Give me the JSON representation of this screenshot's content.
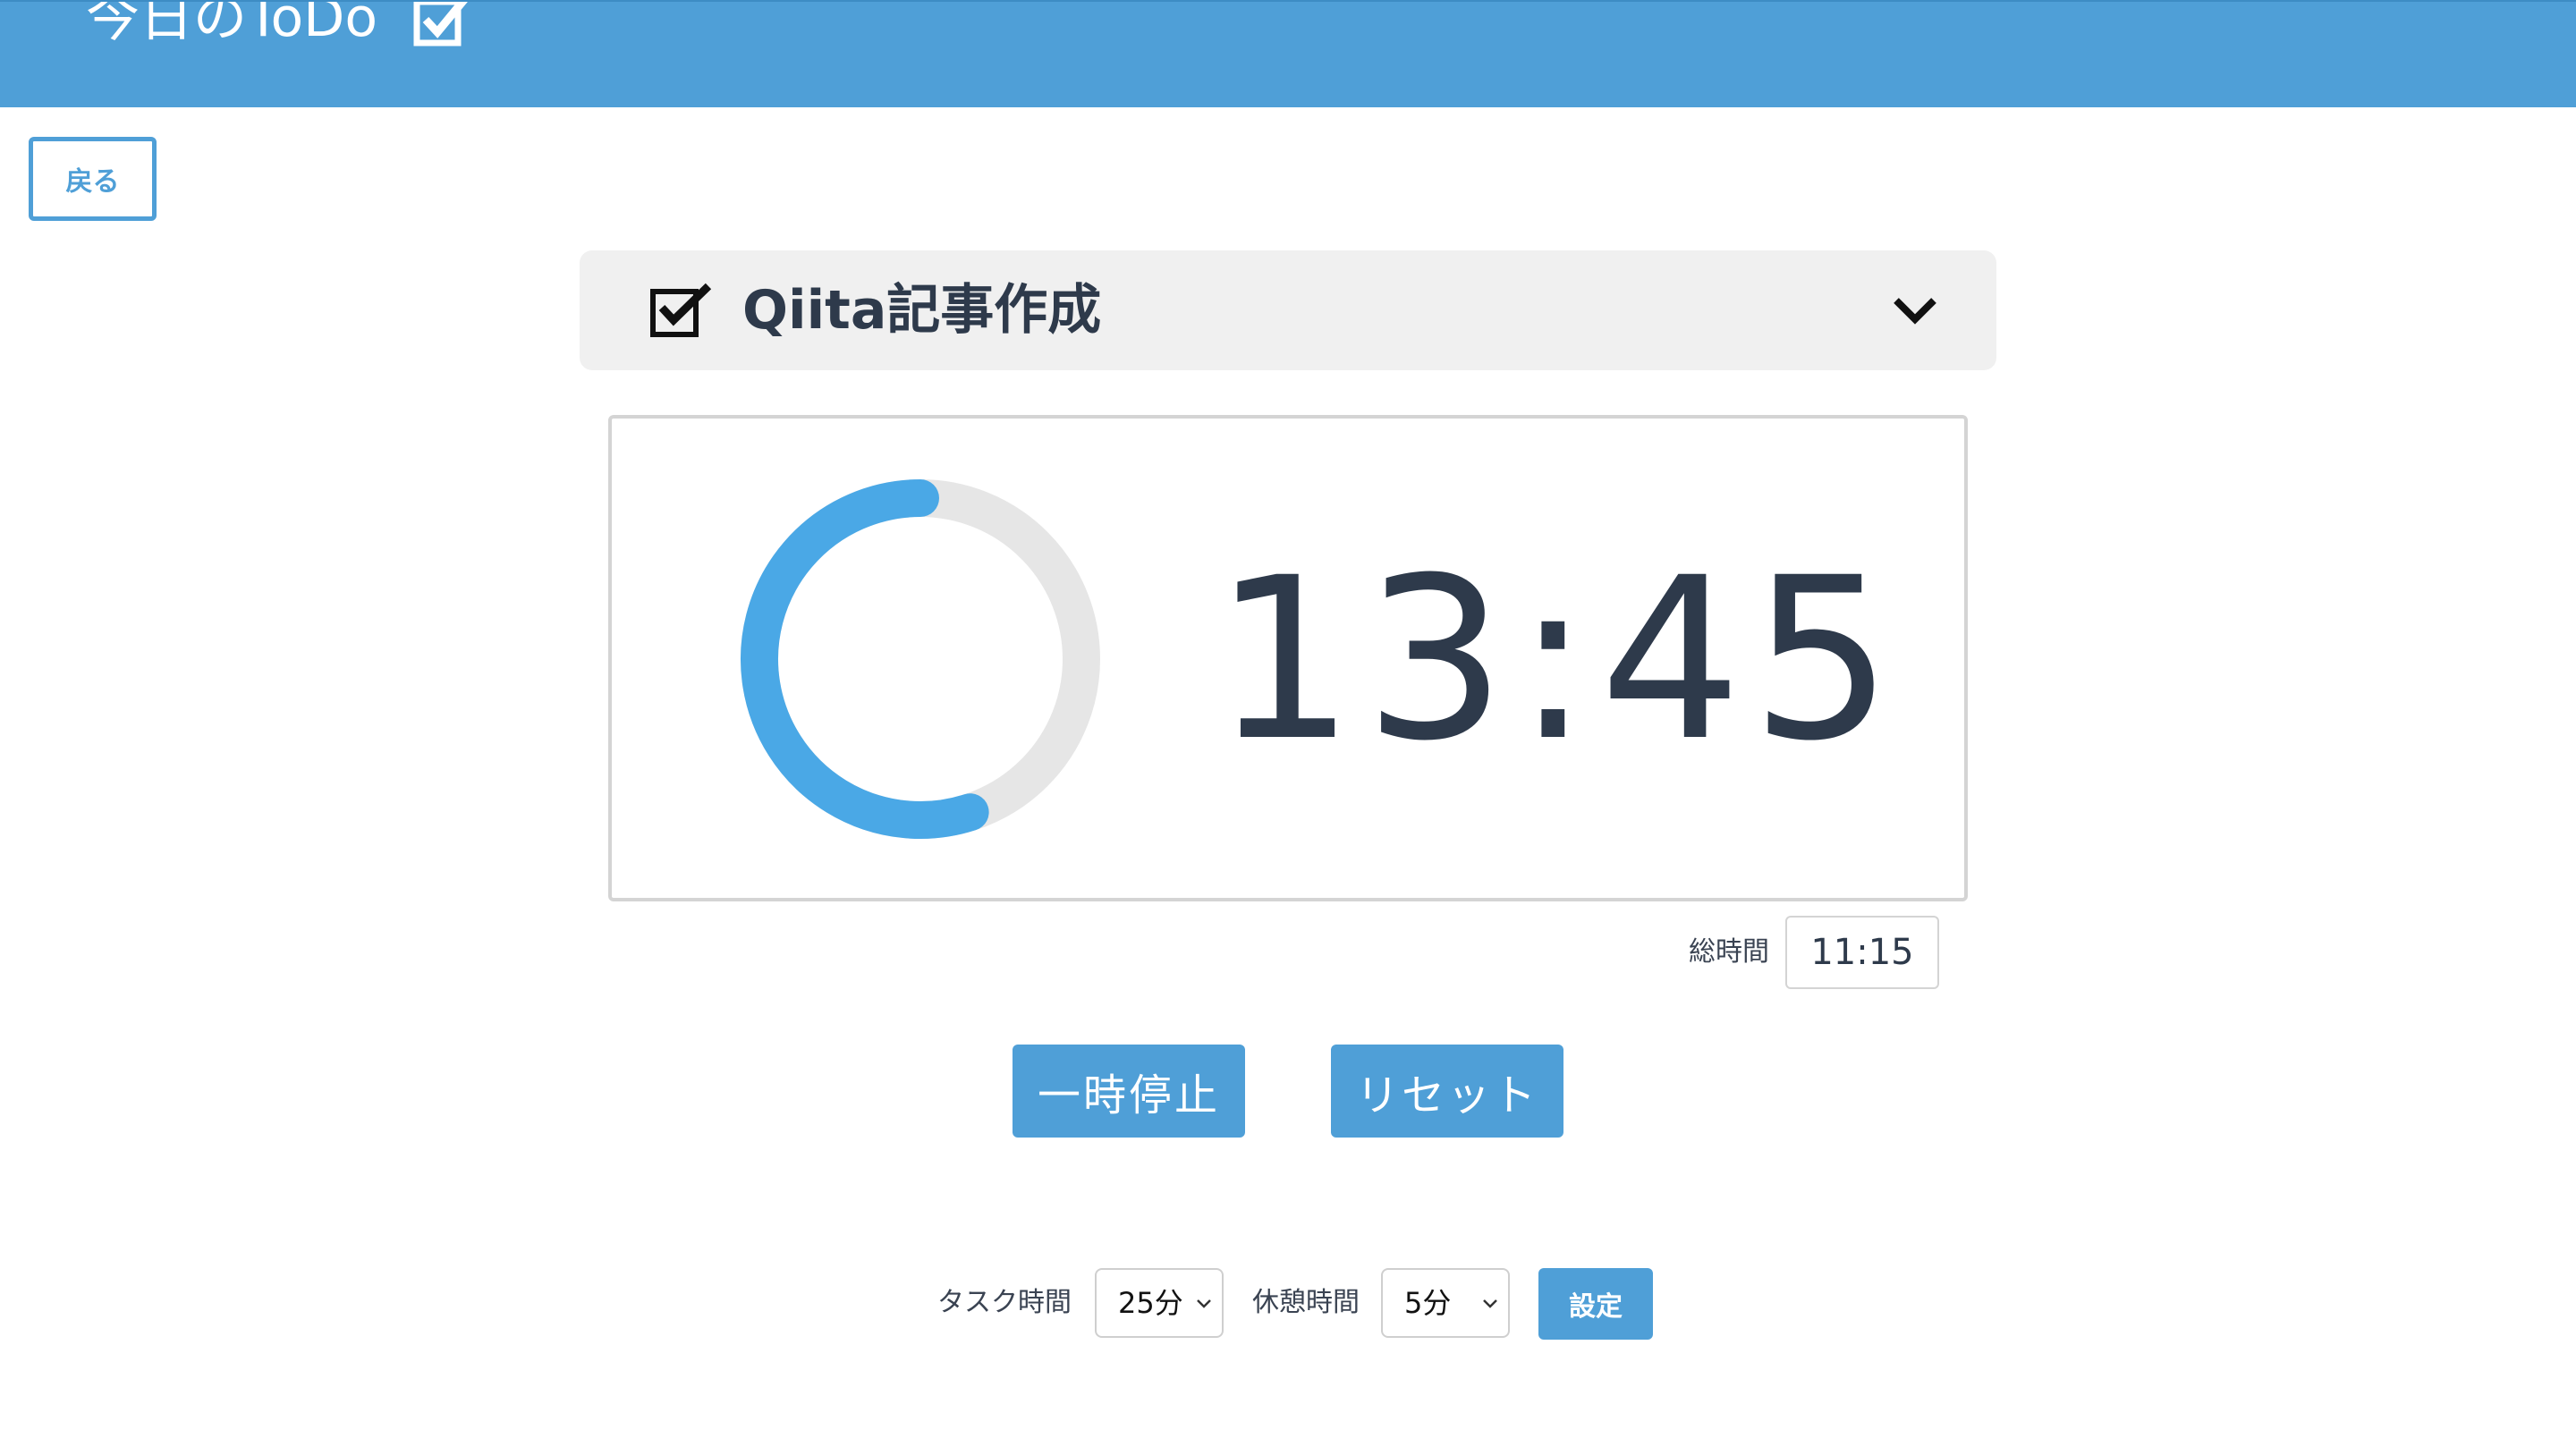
{
  "header": {
    "title": "今日のToDo",
    "icon": "checkbox-checked-icon"
  },
  "nav": {
    "back_label": "戻る"
  },
  "task": {
    "title": "Qiita記事作成",
    "icon": "checkbox-checked-icon",
    "expand_icon": "chevron-down-icon"
  },
  "timer": {
    "remaining": "13:45",
    "progress_fraction": 0.55,
    "progress_color": "#4aa8e6",
    "track_color": "#e6e6e6"
  },
  "total": {
    "label": "総時間",
    "value": "11:15"
  },
  "controls": {
    "pause_label": "一時停止",
    "reset_label": "リセット"
  },
  "settings": {
    "task_time_label": "タスク時間",
    "task_time_value": "25分",
    "break_time_label": "休憩時間",
    "break_time_value": "5分",
    "set_label": "設定"
  },
  "colors": {
    "accent": "#4f9fd7",
    "text": "#2e3a4b"
  }
}
